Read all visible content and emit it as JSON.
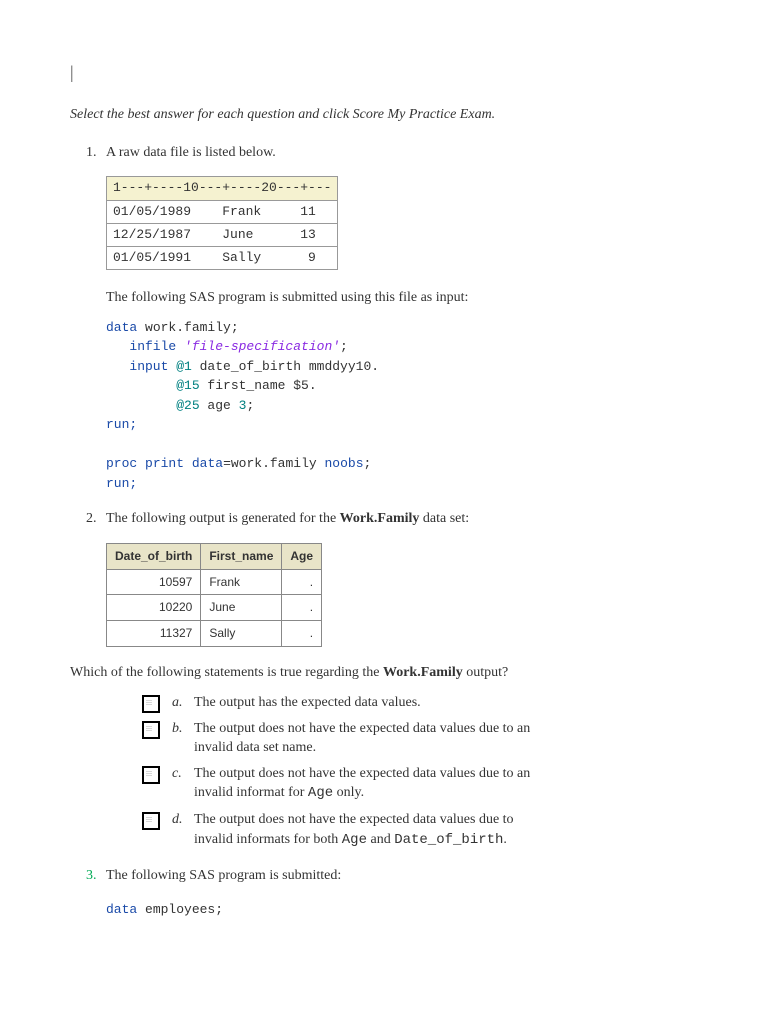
{
  "cursor": "|",
  "instructions": "Select the best answer for each question and click Score My Practice Exam.",
  "q1": {
    "number": "1.",
    "prompt": "A raw data file is listed below.",
    "raw": {
      "ruler": "1---+----10---+----20---+---",
      "rows": [
        "01/05/1989    Frank     11",
        "12/25/1987    June      13",
        "01/05/1991    Sally      9"
      ]
    },
    "post": "The following SAS program is submitted using this file as input:",
    "code": {
      "l1a": "data",
      "l1b": " work.family;",
      "l2a": "   infile ",
      "l2b": "'file-specification'",
      "l2c": ";",
      "l3a": "   input ",
      "l3b": "@1",
      "l3c": " date_of_birth mmddyy10.",
      "l4a": "         @15",
      "l4b": " first_name ",
      "l4c": "$5.",
      "l5a": "         @25",
      "l5b": " age ",
      "l5c": "3",
      "l5d": ";",
      "l6": "run;",
      "l7": "",
      "l8a": "proc",
      "l8b": " ",
      "l8c": "print",
      "l8d": " ",
      "l8e": "data",
      "l8f": "=work.family ",
      "l8g": "noobs",
      "l8h": ";",
      "l9": "run;"
    }
  },
  "q2": {
    "number": "2.",
    "prompt_a": "The following output is generated for the ",
    "prompt_bold": "Work.Family",
    "prompt_b": " data set:",
    "table": {
      "headers": [
        "Date_of_birth",
        "First_name",
        "Age"
      ],
      "rows": [
        [
          "10597",
          "Frank",
          "."
        ],
        [
          "10220",
          "June",
          "."
        ],
        [
          "11327",
          "Sally",
          "."
        ]
      ]
    },
    "which_a": "Which of the following statements is true regarding the ",
    "which_bold": "Work.Family",
    "which_b": " output?",
    "options": [
      {
        "letter": "a.",
        "text_before": "The output has the expected data values.",
        "mono1": "",
        "text_mid": "",
        "mono2": "",
        "text_after": ""
      },
      {
        "letter": "b.",
        "text_before": "The output does not have the expected data values due to an invalid data set name.",
        "mono1": "",
        "text_mid": "",
        "mono2": "",
        "text_after": ""
      },
      {
        "letter": "c.",
        "text_before": "The output does not have the expected data values due to an invalid informat for ",
        "mono1": "Age",
        "text_mid": " only.",
        "mono2": "",
        "text_after": ""
      },
      {
        "letter": "d.",
        "text_before": "The output does not have the expected data values due to invalid informats for both ",
        "mono1": "Age",
        "text_mid": " and ",
        "mono2": "Date_of_birth",
        "text_after": "."
      }
    ]
  },
  "q3": {
    "number": "3.",
    "prompt": "The following SAS program is submitted:",
    "code": {
      "l1a": "data",
      "l1b": " employees;"
    }
  }
}
